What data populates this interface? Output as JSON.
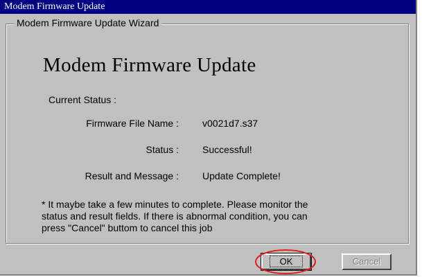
{
  "window": {
    "title": "Modem Firmware Update"
  },
  "wizard": {
    "group_label": "Modem Firmware Update Wizard",
    "heading": "Modem Firmware Update",
    "current_status_label": "Current Status :",
    "fields": [
      {
        "label": "Firmware File Name :",
        "value": "v0021d7.s37"
      },
      {
        "label": "Status :",
        "value": "Successful!"
      },
      {
        "label": "Result and Message :",
        "value": "Update Complete!"
      }
    ],
    "note_lines": [
      "* It maybe take a few minutes to complete. Please monitor the",
      "status and result  fields. If there is abnormal condition, you can",
      "press \"Cancel\" buttom to cancel this job"
    ]
  },
  "buttons": {
    "ok": "OK",
    "cancel": "Cancel",
    "cancel_enabled": false
  },
  "annotation": {
    "highlight_color": "#e02020",
    "highlighted": "ok-button"
  }
}
